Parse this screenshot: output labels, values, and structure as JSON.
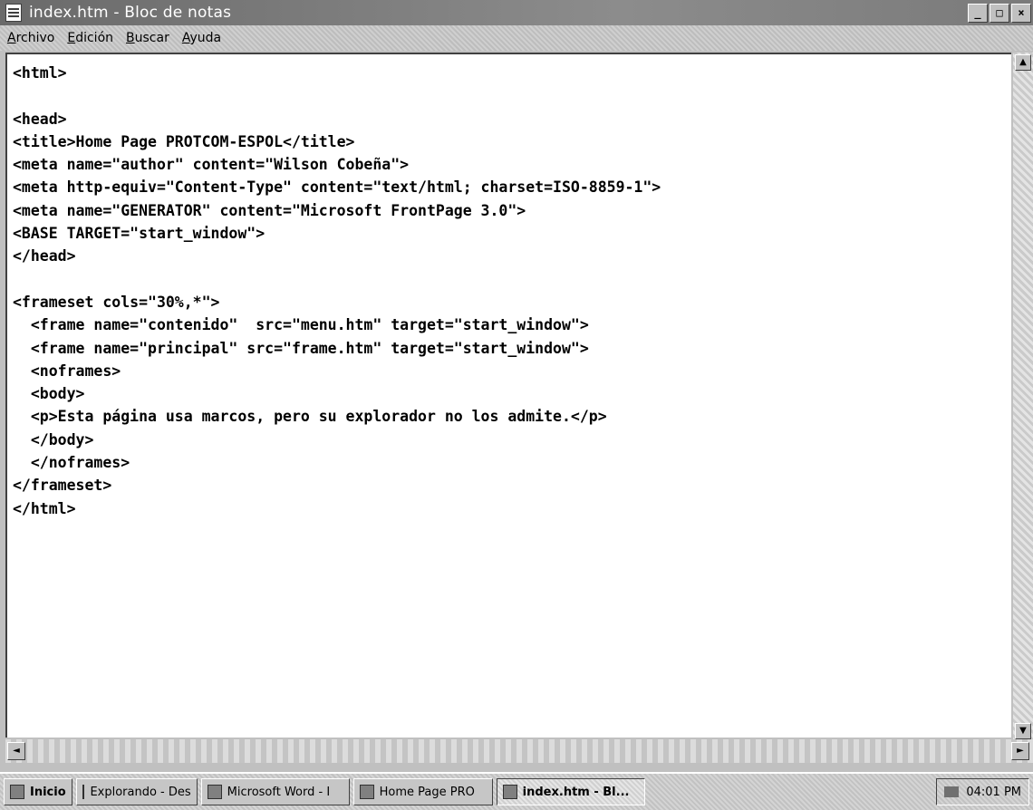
{
  "window": {
    "title": "index.htm - Bloc de notas",
    "buttons": {
      "minimize": "_",
      "maximize": "□",
      "close": "×"
    }
  },
  "menubar": {
    "items": [
      {
        "first": "A",
        "rest": "rchivo"
      },
      {
        "first": "E",
        "rest": "dición"
      },
      {
        "first": "B",
        "rest": "uscar"
      },
      {
        "first": "A",
        "rest": "yuda"
      }
    ]
  },
  "editor": {
    "content": "<html>\n\n<head>\n<title>Home Page PROTCOM-ESPOL</title>\n<meta name=\"author\" content=\"Wilson Cobeña\">\n<meta http-equiv=\"Content-Type\" content=\"text/html; charset=ISO-8859-1\">\n<meta name=\"GENERATOR\" content=\"Microsoft FrontPage 3.0\">\n<BASE TARGET=\"start_window\">\n</head>\n\n<frameset cols=\"30%,*\">\n  <frame name=\"contenido\"  src=\"menu.htm\" target=\"start_window\">\n  <frame name=\"principal\" src=\"frame.htm\" target=\"start_window\">\n  <noframes>\n  <body>\n  <p>Esta página usa marcos, pero su explorador no los admite.</p>\n  </body>\n  </noframes>\n</frameset>\n</html>"
  },
  "scrollbars": {
    "up": "▲",
    "down": "▼",
    "left": "◄",
    "right": "►"
  },
  "taskbar": {
    "start": "Inicio",
    "tasks": [
      {
        "label": "Explorando - Des",
        "active": false
      },
      {
        "label": "Microsoft Word - I",
        "active": false
      },
      {
        "label": "Home Page PRO",
        "active": false
      },
      {
        "label": "index.htm - Bl...",
        "active": true
      }
    ],
    "clock": "04:01 PM"
  },
  "colors": {
    "titlebar": "#7a7a7a",
    "editor_bg": "#ffffff",
    "chrome": "#c0c0c0"
  }
}
